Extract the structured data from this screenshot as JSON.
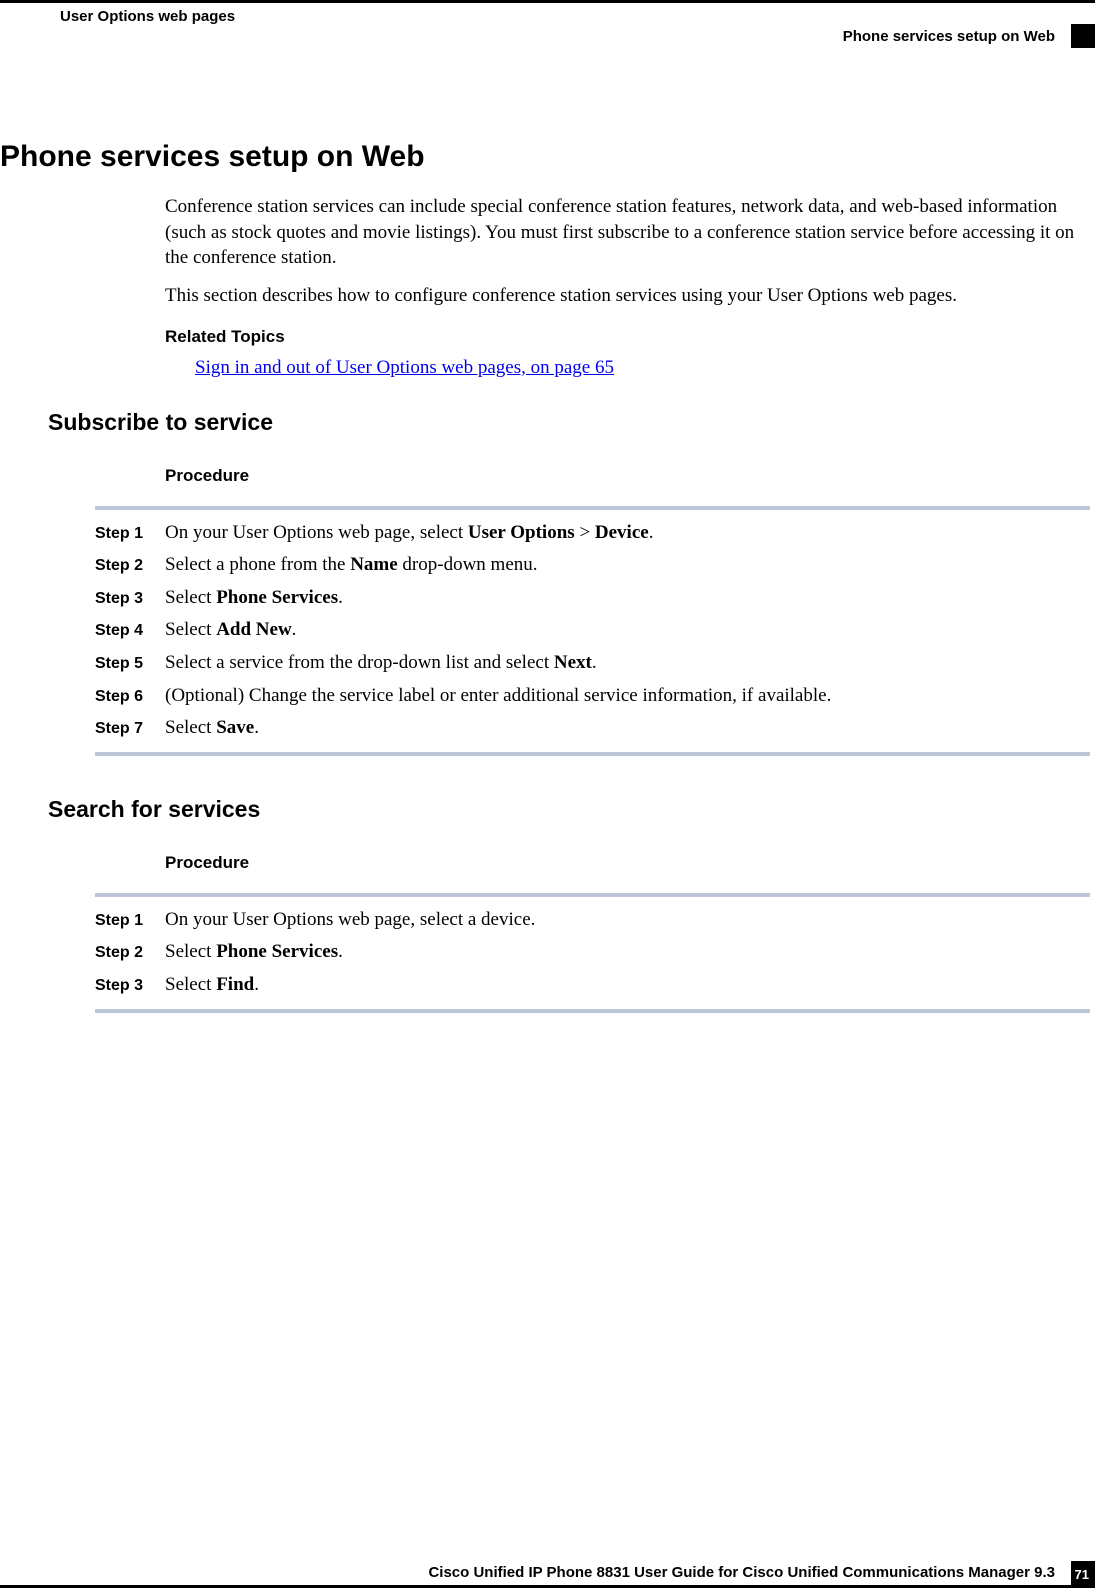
{
  "header": {
    "left": "User Options web pages",
    "right": "Phone services setup on Web"
  },
  "main": {
    "title": "Phone services setup on Web",
    "para1": "Conference station services can include special conference station features, network data, and web-based information (such as stock quotes and movie listings). You must first subscribe to a conference station service before accessing it on the conference station.",
    "para2": "This section describes how to configure conference station services using your User Options web pages.",
    "related_heading": "Related Topics",
    "related_link": "Sign in and out of User Options web pages,  on page 65"
  },
  "section1": {
    "title": "Subscribe to service",
    "procedure_label": "Procedure",
    "steps": [
      {
        "label": "Step 1",
        "pre": "On your User Options web page, select ",
        "b1": "User Options",
        "mid": " > ",
        "b2": "Device",
        "post": "."
      },
      {
        "label": "Step 2",
        "pre": "Select a phone from the ",
        "b1": "Name",
        "mid": " drop-down menu.",
        "b2": "",
        "post": ""
      },
      {
        "label": "Step 3",
        "pre": "Select ",
        "b1": "Phone Services",
        "mid": ".",
        "b2": "",
        "post": ""
      },
      {
        "label": "Step 4",
        "pre": "Select ",
        "b1": "Add New",
        "mid": ".",
        "b2": "",
        "post": ""
      },
      {
        "label": "Step 5",
        "pre": "Select a service from the drop-down list and select ",
        "b1": "Next",
        "mid": ".",
        "b2": "",
        "post": ""
      },
      {
        "label": "Step 6",
        "pre": "(Optional) Change the service label or enter additional service information, if available.",
        "b1": "",
        "mid": "",
        "b2": "",
        "post": ""
      },
      {
        "label": "Step 7",
        "pre": "Select ",
        "b1": "Save",
        "mid": ".",
        "b2": "",
        "post": ""
      }
    ]
  },
  "section2": {
    "title": "Search for services",
    "procedure_label": "Procedure",
    "steps": [
      {
        "label": "Step 1",
        "pre": "On your User Options web page, select a device.",
        "b1": "",
        "mid": "",
        "b2": "",
        "post": ""
      },
      {
        "label": "Step 2",
        "pre": "Select ",
        "b1": "Phone Services",
        "mid": ".",
        "b2": "",
        "post": ""
      },
      {
        "label": "Step 3",
        "pre": "Select ",
        "b1": "Find",
        "mid": ".",
        "b2": "",
        "post": ""
      }
    ]
  },
  "footer": {
    "title": "Cisco Unified IP Phone 8831 User Guide for Cisco Unified Communications Manager 9.3",
    "page": "71"
  }
}
